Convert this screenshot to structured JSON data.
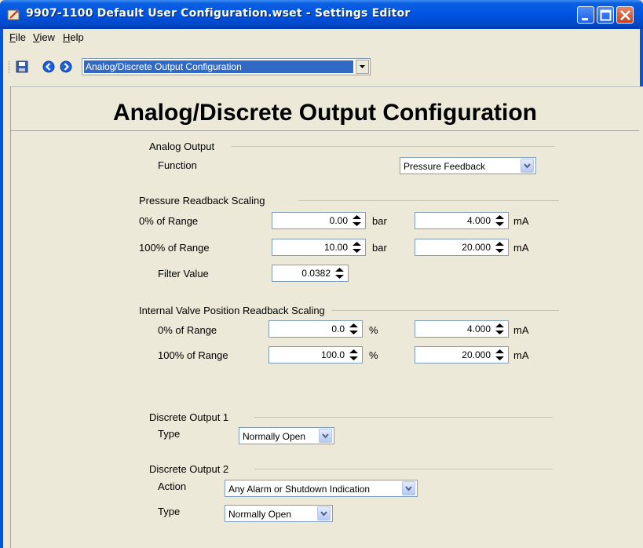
{
  "window": {
    "title": "9907-1100 Default User Configuration.wset - Settings Editor"
  },
  "menu": [
    {
      "mnemonic": "F",
      "rest": "ile"
    },
    {
      "mnemonic": "V",
      "rest": "iew"
    },
    {
      "mnemonic": "H",
      "rest": "elp"
    }
  ],
  "toolbar": {
    "page_selector": "Analog/Discrete Output Configuration"
  },
  "page": {
    "title": "Analog/Discrete Output Configuration"
  },
  "analog_output": {
    "group_label": "Analog Output",
    "function_label": "Function",
    "function_value": "Pressure Feedback"
  },
  "pressure_scaling": {
    "group_label": "Pressure Readback Scaling",
    "row0_label": "0% of Range",
    "row0_value": "0.00",
    "row0_unit": "bar",
    "row0_ma": "4.000",
    "row100_label": "100% of Range",
    "row100_value": "10.00",
    "row100_unit": "bar",
    "row100_ma": "20.000",
    "ma_unit": "mA",
    "filter_label": "Filter Value",
    "filter_value": "0.0382"
  },
  "valve_scaling": {
    "group_label": "Internal Valve Position Readback Scaling",
    "row0_label": "0% of Range",
    "row0_value": "0.0",
    "row0_unit": "%",
    "row0_ma": "4.000",
    "row100_label": "100% of Range",
    "row100_value": "100.0",
    "row100_unit": "%",
    "row100_ma": "20.000",
    "ma_unit": "mA"
  },
  "discrete_output_1": {
    "group_label": "Discrete Output 1",
    "type_label": "Type",
    "type_value": "Normally Open"
  },
  "discrete_output_2": {
    "group_label": "Discrete Output 2",
    "action_label": "Action",
    "action_value": "Any Alarm or Shutdown Indication",
    "type_label": "Type",
    "type_value": "Normally Open"
  }
}
